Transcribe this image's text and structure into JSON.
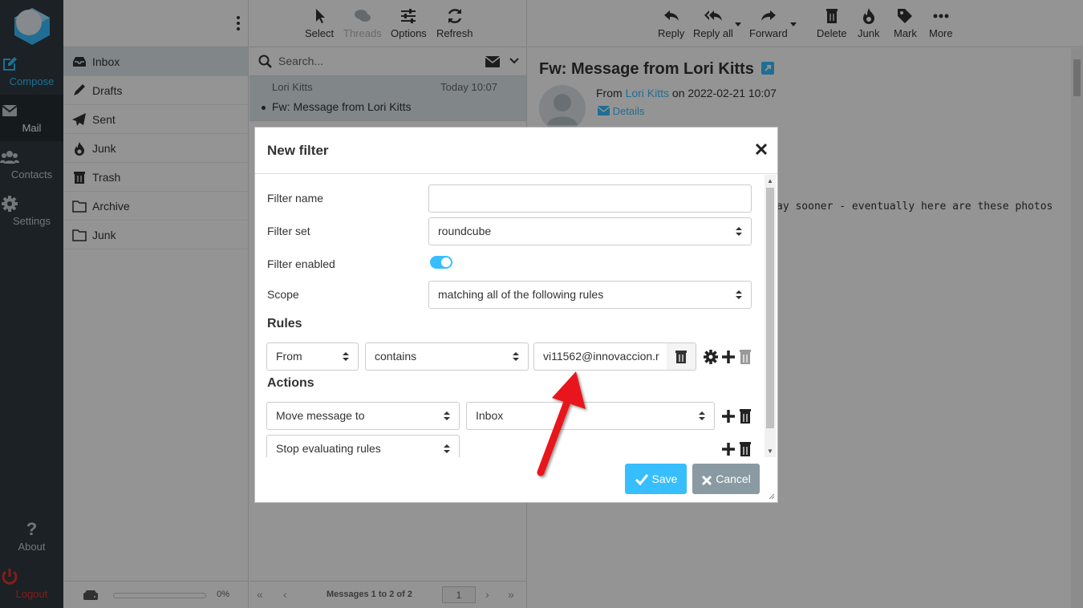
{
  "nav": {
    "compose": "Compose",
    "mail": "Mail",
    "contacts": "Contacts",
    "settings": "Settings",
    "about": "About",
    "logout": "Logout"
  },
  "folders": {
    "items": [
      {
        "label": "Inbox",
        "icon": "inbox-icon"
      },
      {
        "label": "Drafts",
        "icon": "pencil-icon"
      },
      {
        "label": "Sent",
        "icon": "paper-plane-icon"
      },
      {
        "label": "Junk",
        "icon": "fire-icon"
      },
      {
        "label": "Trash",
        "icon": "trash-icon"
      },
      {
        "label": "Archive",
        "icon": "folder-icon"
      },
      {
        "label": "Junk",
        "icon": "folder-icon"
      }
    ],
    "quota_percent": "0%"
  },
  "list_toolbar": {
    "select": "Select",
    "threads": "Threads",
    "options": "Options",
    "refresh": "Refresh"
  },
  "search": {
    "placeholder": "Search..."
  },
  "messages": [
    {
      "from": "Lori Kitts",
      "date": "Today 10:07",
      "subject": "Fw: Message from Lori Kitts"
    }
  ],
  "pager": {
    "count": "Messages 1 to 2 of 2",
    "page": "1"
  },
  "preview_toolbar": {
    "reply": "Reply",
    "reply_all": "Reply all",
    "forward": "Forward",
    "delete": "Delete",
    "junk": "Junk",
    "mark": "Mark",
    "more": "More"
  },
  "preview": {
    "title": "Fw: Message from Lori Kitts",
    "from_prefix": "From",
    "from_name": "Lori Kitts",
    "from_suffix": "on 2022-02-21 10:07",
    "details": "Details",
    "body_snippet": "ay sooner - eventually here are these photos"
  },
  "dialog": {
    "title": "New filter",
    "filter_name_label": "Filter name",
    "filter_name_value": "",
    "filter_set_label": "Filter set",
    "filter_set_value": "roundcube",
    "filter_enabled_label": "Filter enabled",
    "filter_enabled": true,
    "scope_label": "Scope",
    "scope_value": "matching all of the following rules",
    "rules_heading": "Rules",
    "rule": {
      "header": "From",
      "operator": "contains",
      "value": "vi11562@innovaccion.r"
    },
    "actions_heading": "Actions",
    "actions": [
      {
        "type": "Move message to",
        "target": "Inbox"
      },
      {
        "type": "Stop evaluating rules"
      }
    ],
    "save": "Save",
    "cancel": "Cancel"
  },
  "colors": {
    "accent": "#37beff",
    "rail": "#2f3a3f",
    "annotation_arrow": "#e8191c"
  }
}
